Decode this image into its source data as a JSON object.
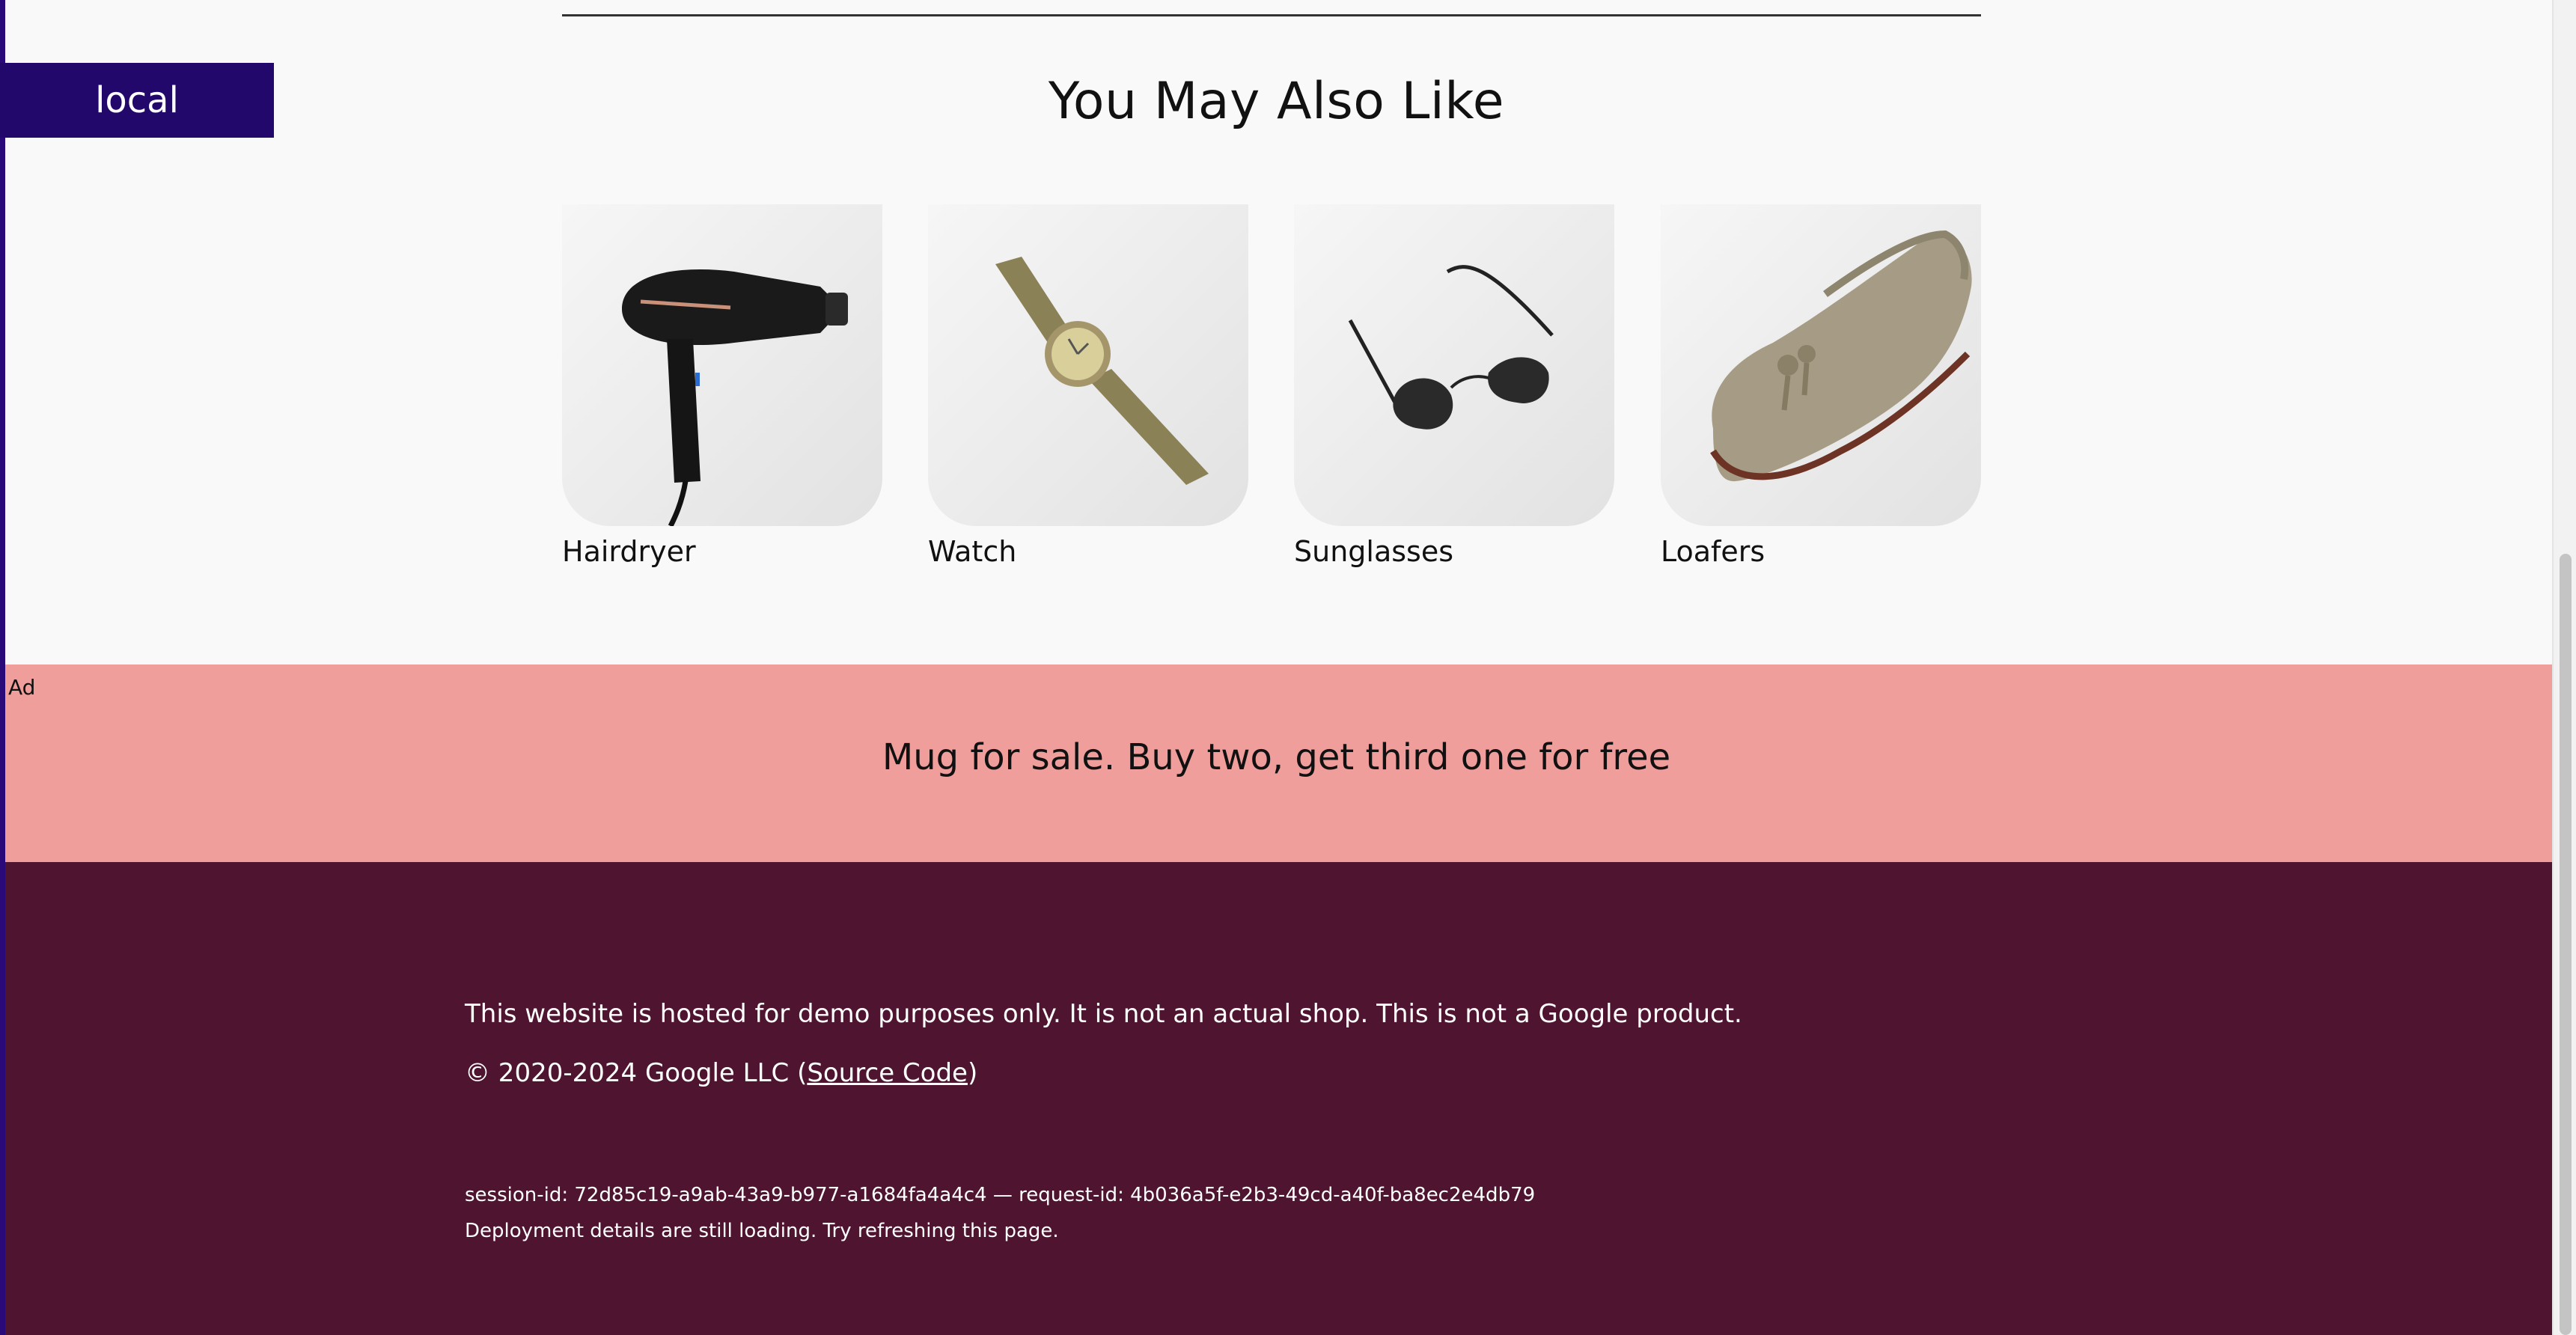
{
  "env_badge": "local",
  "recommendations": {
    "title": "You May Also Like",
    "items": [
      {
        "name": "Hairdryer",
        "icon": "hairdryer-image"
      },
      {
        "name": "Watch",
        "icon": "watch-image"
      },
      {
        "name": "Sunglasses",
        "icon": "sunglasses-image"
      },
      {
        "name": "Loafers",
        "icon": "loafers-image"
      }
    ]
  },
  "ad": {
    "label": "Ad",
    "text": "Mug for sale. Buy two, get third one for free",
    "color": "#f09e9c"
  },
  "footer": {
    "disclaimer": "This website is hosted for demo purposes only. It is not an actual shop. This is not a Google product.",
    "copyright_prefix": "© 2020-2024 Google LLC (",
    "source_link": "Source Code",
    "copyright_suffix": ")",
    "session_line": "session-id: 72d85c19-a9ab-43a9-b977-a1684fa4a4c4 — request-id: 4b036a5f-e2b3-49cd-a40f-ba8ec2e4db79",
    "deployment_note": "Deployment details are still loading. Try refreshing this page.",
    "color": "#4e1430"
  },
  "colors": {
    "badge": "#23086b",
    "page_bg": "#f9f9f9"
  }
}
